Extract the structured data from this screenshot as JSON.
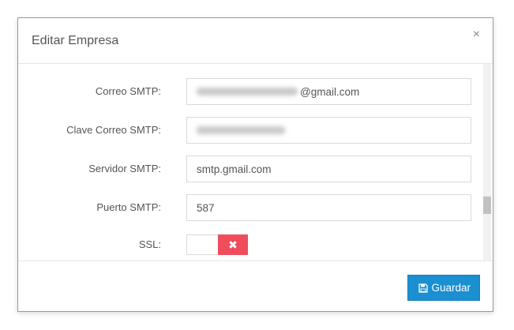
{
  "modal": {
    "title": "Editar Empresa",
    "close_symbol": "×",
    "close_icon": "close-icon"
  },
  "form": {
    "smtp_email": {
      "label": "Correo SMTP:",
      "value_visible_suffix": "@gmail.com"
    },
    "smtp_password": {
      "label": "Clave Correo SMTP:"
    },
    "smtp_server": {
      "label": "Servidor SMTP:",
      "value": "smtp.gmail.com"
    },
    "smtp_port": {
      "label": "Puerto SMTP:",
      "value": "587"
    },
    "ssl": {
      "label": "SSL:",
      "state": "off",
      "off_symbol": "✖"
    }
  },
  "footer": {
    "save_label": "Guardar",
    "save_icon": "floppy-disk-icon"
  },
  "colors": {
    "primary": "#1a8fd1",
    "danger": "#f04c5c"
  }
}
